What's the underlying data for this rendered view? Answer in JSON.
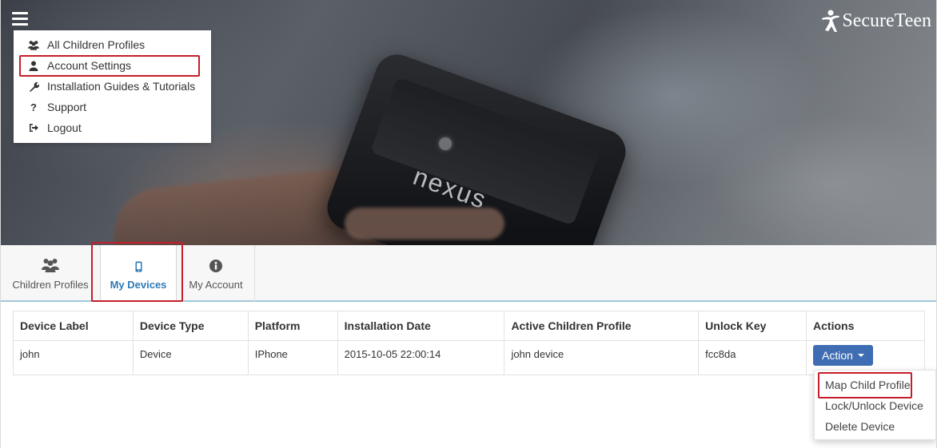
{
  "brand": {
    "name": "SecureTeen"
  },
  "hero": {
    "phone_brand": "nexus"
  },
  "menu": {
    "items": [
      {
        "label": "All Children Profiles",
        "icon": "users-icon"
      },
      {
        "label": "Account Settings",
        "icon": "user-icon"
      },
      {
        "label": "Installation Guides & Tutorials",
        "icon": "wrench-icon"
      },
      {
        "label": "Support",
        "icon": "question-icon"
      },
      {
        "label": "Logout",
        "icon": "logout-icon"
      }
    ],
    "highlighted": "Account Settings"
  },
  "tabs": [
    {
      "label": "Children Profiles",
      "icon": "users-icon"
    },
    {
      "label": "My Devices",
      "icon": "mobile-icon",
      "active": true
    },
    {
      "label": "My Account",
      "icon": "info-icon"
    }
  ],
  "table": {
    "headers": [
      "Device Label",
      "Device Type",
      "Platform",
      "Installation Date",
      "Active Children Profile",
      "Unlock Key",
      "Actions"
    ],
    "rows": [
      {
        "device_label": "john",
        "device_type": "Device",
        "platform": "IPhone",
        "installation_date": "2015-10-05 22:00:14",
        "active_profile": "john device",
        "unlock_key": "fcc8da",
        "action_label": "Action"
      }
    ]
  },
  "action_menu": {
    "items": [
      "Map Child Profile",
      "Lock/Unlock Device",
      "Delete Device"
    ],
    "highlighted": "Map Child Profile"
  },
  "colors": {
    "accent_blue": "#2d7bb5",
    "button_blue": "#3f6db3",
    "highlight_red": "#c41e2a",
    "tab_underline": "#9fc8d9"
  }
}
